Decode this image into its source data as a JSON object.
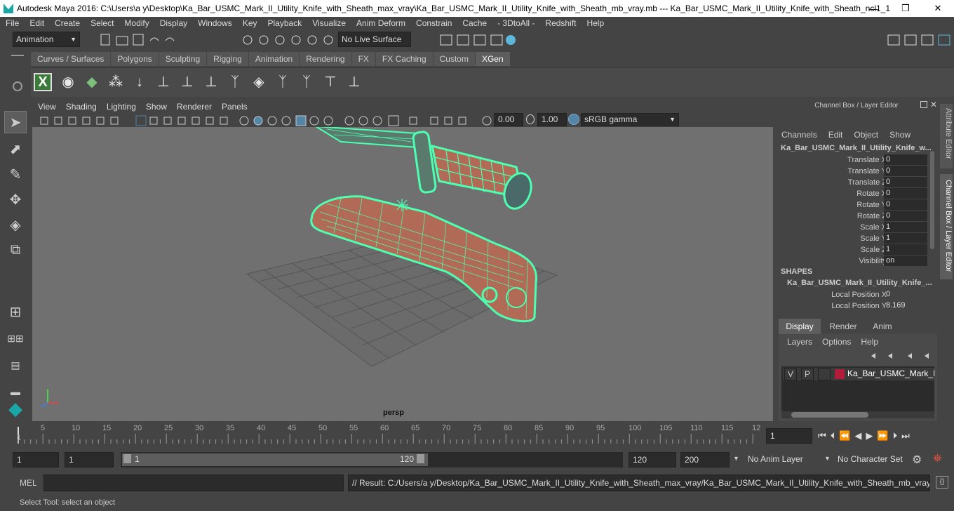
{
  "window": {
    "title": "Autodesk Maya 2016: C:\\Users\\a y\\Desktop\\Ka_Bar_USMC_Mark_II_Utility_Knife_with_Sheath_max_vray\\Ka_Bar_USMC_Mark_II_Utility_Knife_with_Sheath_mb_vray.mb   ---   Ka_Bar_USMC_Mark_II_Utility_Knife_with_Sheath_ncl1_1",
    "minimize": "—",
    "maximize": "❐",
    "close": "✕"
  },
  "menu": [
    "File",
    "Edit",
    "Create",
    "Select",
    "Modify",
    "Display",
    "Windows",
    "Key",
    "Playback",
    "Visualize",
    "Anim Deform",
    "Constrain",
    "Cache",
    "- 3DtoAll -",
    "Redshift",
    "Help"
  ],
  "status": {
    "mode": "Animation",
    "live_surface": "No Live Surface"
  },
  "shelf": {
    "tabs": [
      "Curves / Surfaces",
      "Polygons",
      "Sculpting",
      "Rigging",
      "Animation",
      "Rendering",
      "FX",
      "FX Caching",
      "Custom",
      "XGen"
    ],
    "active_tab": "XGen"
  },
  "viewport": {
    "menu": [
      "View",
      "Shading",
      "Lighting",
      "Show",
      "Renderer",
      "Panels"
    ],
    "field1": "0.00",
    "field2": "1.00",
    "color_space": "sRGB gamma",
    "camera_label": "persp"
  },
  "channel_box": {
    "title": "Channel Box / Layer Editor",
    "menu": [
      "Channels",
      "Edit",
      "Object",
      "Show"
    ],
    "object_name": "Ka_Bar_USMC_Mark_II_Utility_Knife_w...",
    "channels": [
      {
        "label": "Translate X",
        "value": "0"
      },
      {
        "label": "Translate Y",
        "value": "0"
      },
      {
        "label": "Translate Z",
        "value": "0"
      },
      {
        "label": "Rotate X",
        "value": "0"
      },
      {
        "label": "Rotate Y",
        "value": "0"
      },
      {
        "label": "Rotate Z",
        "value": "0"
      },
      {
        "label": "Scale X",
        "value": "1"
      },
      {
        "label": "Scale Y",
        "value": "1"
      },
      {
        "label": "Scale Z",
        "value": "1"
      },
      {
        "label": "Visibility",
        "value": "on"
      }
    ],
    "shapes_header": "SHAPES",
    "shape_name": "Ka_Bar_USMC_Mark_II_Utility_Knife_...",
    "shape_channels": [
      {
        "label": "Local Position X",
        "value": "0"
      },
      {
        "label": "Local Position Y",
        "value": "8.169"
      }
    ]
  },
  "side_tabs": {
    "attribute_editor": "Attribute Editor",
    "channel_box": "Channel Box / Layer Editor"
  },
  "layer_editor": {
    "tabs": [
      "Display",
      "Render",
      "Anim"
    ],
    "active_tab": "Display",
    "menu": [
      "Layers",
      "Options",
      "Help"
    ],
    "layer": {
      "v": "V",
      "p": "P",
      "name": "Ka_Bar_USMC_Mark_II_Ut",
      "color": "#b01c3a"
    }
  },
  "timeline": {
    "ticks": [
      "1",
      "5",
      "10",
      "15",
      "20",
      "25",
      "30",
      "35",
      "40",
      "45",
      "50",
      "55",
      "60",
      "65",
      "70",
      "75",
      "80",
      "85",
      "90",
      "95",
      "100",
      "105",
      "110",
      "115",
      "12"
    ],
    "current_frame": "1"
  },
  "range": {
    "start": "1",
    "playback_start": "1",
    "slider_start": "1",
    "slider_end": "120",
    "playback_end": "120",
    "end": "200",
    "anim_layer": "No Anim Layer",
    "character_set": "No Character Set"
  },
  "command_line": {
    "label": "MEL",
    "result": "// Result: C:/Users/a y/Desktop/Ka_Bar_USMC_Mark_II_Utility_Knife_with_Sheath_max_vray/Ka_Bar_USMC_Mark_II_Utility_Knife_with_Sheath_mb_vray.mb"
  },
  "help_line": "Select Tool: select an object",
  "colors": {
    "accent": "#5285a6",
    "wireframe": "#4dffb0",
    "viewport_bg": "#707070",
    "knife_fill": "#b06a55"
  }
}
